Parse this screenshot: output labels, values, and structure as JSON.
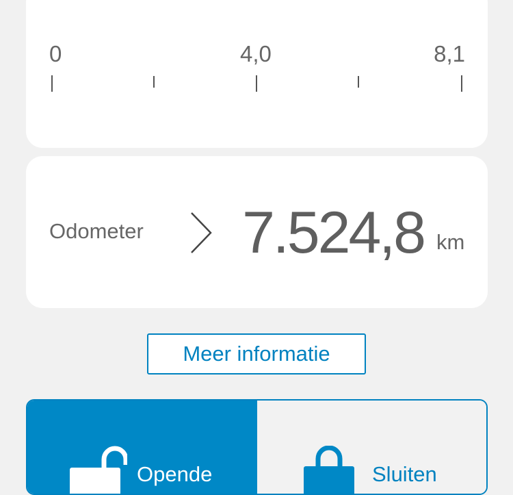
{
  "gauge": {
    "tick_labels": [
      "0",
      "4,0",
      "8,1"
    ]
  },
  "odometer": {
    "label": "Odometer",
    "value": "7.524,8",
    "unit": "km"
  },
  "more_info": {
    "label": "Meer informatie"
  },
  "lock_control": {
    "open_label": "Opende",
    "close_label": "Sluiten",
    "selected": "open"
  },
  "colors": {
    "accent": "#0082c0",
    "selected_bg": "#0088c6",
    "card_bg": "#ffffff",
    "page_bg": "#f1f1f1",
    "text": "#5f5f5f"
  },
  "icons": {
    "odometer_chevron": "chevron-right-icon",
    "open": "unlocked-padlock-icon",
    "close": "locked-padlock-icon"
  }
}
